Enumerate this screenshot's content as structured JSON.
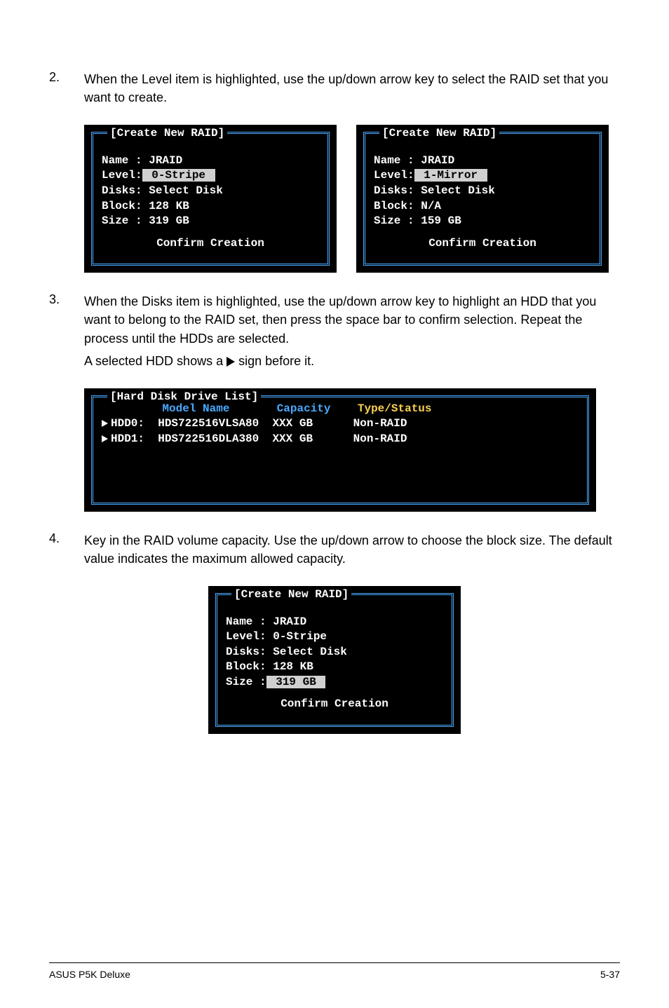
{
  "steps": {
    "s2": {
      "num": "2.",
      "text": "When the Level item is highlighted, use the up/down arrow key to select the RAID set that you want to create."
    },
    "s3": {
      "num": "3.",
      "text": "When the Disks item is highlighted, use the up/down arrow key to highlight an HDD that you want to belong to the RAID set, then press the space bar to confirm selection. Repeat the process until the HDDs are selected.",
      "note_prefix": "A selected HDD shows a ",
      "note_suffix": " sign before it."
    },
    "s4": {
      "num": "4.",
      "text": "Key in the RAID volume capacity. Use the up/down arrow to choose the block size. The default value indicates the maximum allowed capacity."
    }
  },
  "panelA": {
    "title": "[Create New RAID]",
    "name": "Name : JRAID",
    "level_label": "Level:",
    "level_value": " 0-Stripe ",
    "disks": "Disks: Select Disk",
    "block": "Block: 128 KB",
    "size": "Size : 319 GB",
    "confirm": "Confirm Creation"
  },
  "panelB": {
    "title": "[Create New RAID]",
    "name": "Name : JRAID",
    "level_label": "Level:",
    "level_value": " 1-Mirror ",
    "disks": "Disks: Select Disk",
    "block": "Block: N/A",
    "size": "Size : 159 GB",
    "confirm": "Confirm Creation"
  },
  "hdd": {
    "title": "[Hard Disk Drive List]",
    "h_model": "Model Name",
    "h_cap": "Capacity",
    "h_type": "Type/Status",
    "r0_id": "HDD0:",
    "r0_model": "HDS722516VLSA80",
    "r0_cap": "XXX GB",
    "r0_type": "Non-RAID",
    "r1_id": "HDD1:",
    "r1_model": "HDS722516DLA380",
    "r1_cap": "XXX GB",
    "r1_type": "Non-RAID"
  },
  "panelC": {
    "title": "[Create New RAID]",
    "name": "Name : JRAID",
    "level": "Level: 0-Stripe",
    "disks": "Disks: Select Disk",
    "block": "Block: 128 KB",
    "size_label": "Size :",
    "size_value": " 319 GB ",
    "confirm": "Confirm Creation"
  },
  "footer": {
    "left": "ASUS P5K Deluxe",
    "right": "5-37"
  }
}
